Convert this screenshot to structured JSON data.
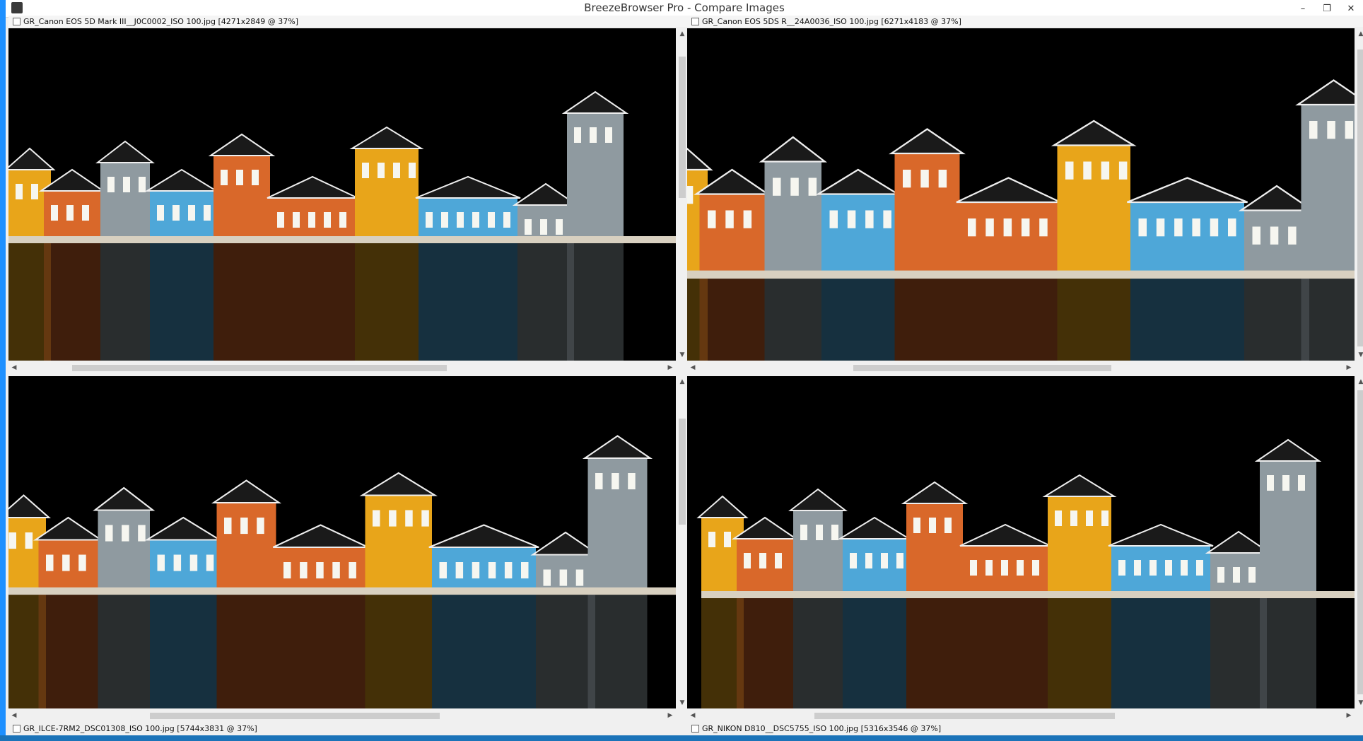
{
  "window": {
    "title": "BreezeBrowser Pro - Compare Images",
    "min_glyph": "–",
    "restore_glyph": "❐",
    "close_glyph": "✕"
  },
  "panes": [
    {
      "label": "GR_Canon EOS 5D Mark III__J0C0002_ISO 100.jpg [4271x2849 @ 37%]"
    },
    {
      "label": "GR_Canon EOS 5DS R__24A0036_ISO 100.jpg [6271x4183 @ 37%]"
    },
    {
      "label": "GR_ILCE-7RM2_DSC01308_ISO 100.jpg [5744x3831 @ 37%]"
    },
    {
      "label": "GR_NIKON D810__DSC5755_ISO 100.jpg [5316x3546 @ 37%]"
    }
  ],
  "scroll": {
    "up_glyph": "▲",
    "down_glyph": "▼",
    "left_glyph": "◀",
    "right_glyph": "▶"
  },
  "colors": {
    "accent": "#1e90ff",
    "taskbar": "#1b73b8",
    "yellow_house": "#e8a51a",
    "orange_house": "#d9682a",
    "blue_house": "#4ea7d8",
    "grey_house": "#8f9aa0",
    "night_sky": "#000000"
  }
}
